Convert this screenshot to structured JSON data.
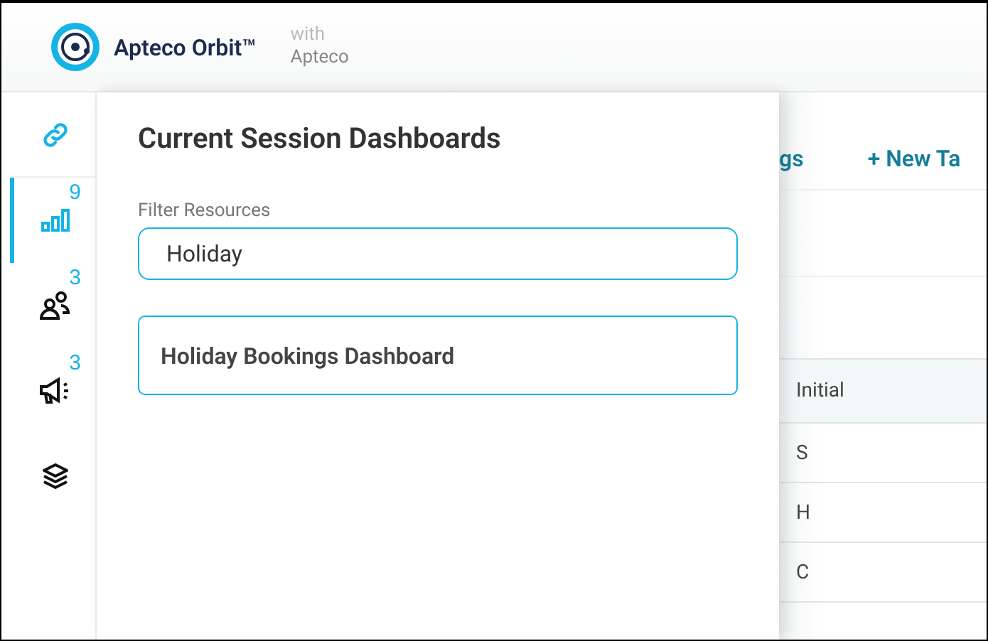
{
  "header": {
    "logo_text": "Apteco Orbit™",
    "with_label": "with",
    "with_name": "Apteco"
  },
  "sidebar": {
    "items": [
      {
        "kind": "link",
        "selected": false
      },
      {
        "kind": "dashboards",
        "badge": "9",
        "selected": true
      },
      {
        "kind": "audiences",
        "badge": "3",
        "selected": false
      },
      {
        "kind": "campaigns",
        "badge": "3",
        "selected": false
      },
      {
        "kind": "layers",
        "selected": false
      }
    ]
  },
  "panel": {
    "title": "Current Session Dashboards",
    "filter_label": "Filter Resources",
    "filter_value": "Holiday",
    "results": [
      "Holiday Bookings Dashboard"
    ]
  },
  "background": {
    "tabs": [
      "gs",
      "+ New Ta"
    ],
    "table": {
      "column": "Initial",
      "rows": [
        "S",
        "H",
        "C"
      ]
    }
  }
}
